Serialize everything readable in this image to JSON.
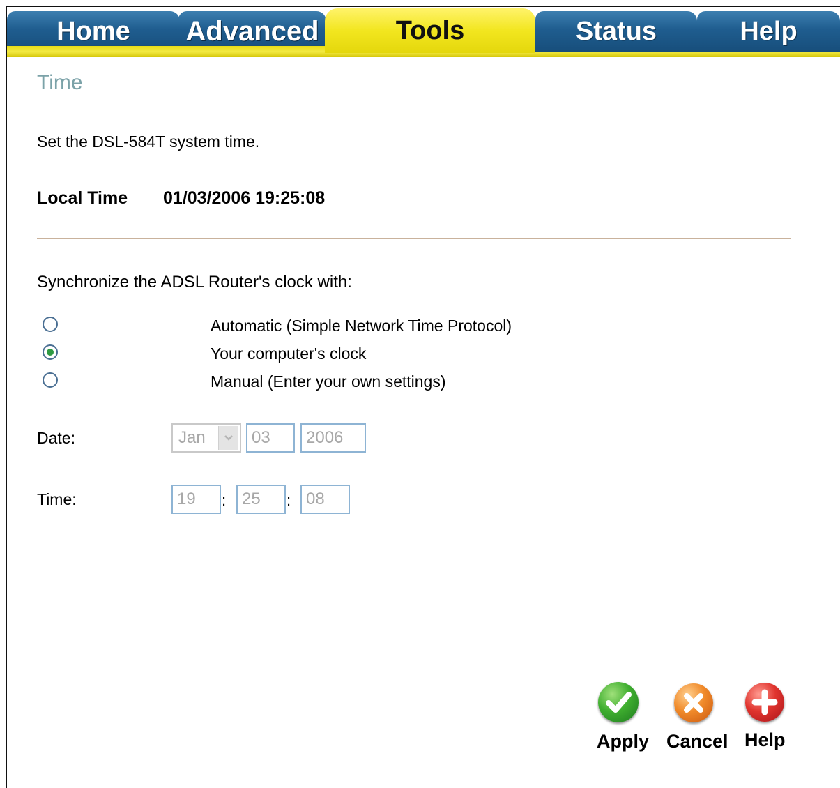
{
  "tabs": [
    {
      "label": "Home",
      "active": false
    },
    {
      "label": "Advanced",
      "active": false
    },
    {
      "label": "Tools",
      "active": true
    },
    {
      "label": "Status",
      "active": false
    },
    {
      "label": "Help",
      "active": false
    }
  ],
  "page": {
    "title": "Time",
    "description": "Set the DSL-584T system time.",
    "local_time_label": "Local Time",
    "local_time_value": "01/03/2006 19:25:08"
  },
  "sync": {
    "label": "Synchronize the ADSL Router's clock with:",
    "options": [
      {
        "label": "Automatic (Simple Network Time Protocol)",
        "checked": false
      },
      {
        "label": "Your computer's clock",
        "checked": true
      },
      {
        "label": "Manual (Enter your own settings)",
        "checked": false
      }
    ]
  },
  "date": {
    "label": "Date:",
    "month": "Jan",
    "day": "03",
    "year": "2006"
  },
  "time": {
    "label": "Time:",
    "hour": "19",
    "minute": "25",
    "second": "08",
    "separator": ":"
  },
  "actions": {
    "apply": "Apply",
    "cancel": "Cancel",
    "help": "Help"
  },
  "colors": {
    "tab_blue": "#1f5d8f",
    "tab_active_yellow": "#f2e61f",
    "title_teal": "#7ba2a8",
    "apply_green": "#2f9a2f",
    "cancel_orange": "#e8731a",
    "help_red": "#d8262a"
  }
}
